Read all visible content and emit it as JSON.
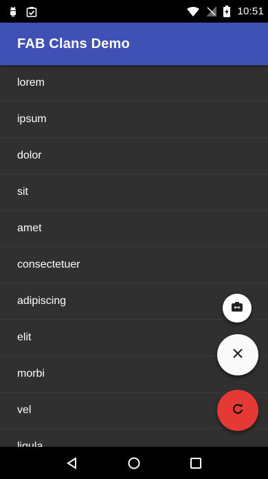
{
  "status_bar": {
    "time": "10:51",
    "icons_left": [
      "android-debug-icon",
      "clipboard-check-icon"
    ],
    "icons_right": [
      "wifi-icon",
      "no-signal-icon",
      "battery-charging-icon"
    ]
  },
  "app_bar": {
    "title": "FAB Clans Demo",
    "color": "#3f51b5"
  },
  "list": {
    "items": [
      "lorem",
      "ipsum",
      "dolor",
      "sit",
      "amet",
      "consectetuer",
      "adipiscing",
      "elit",
      "morbi",
      "vel",
      "ligula"
    ]
  },
  "fabs": {
    "mini_icon": "switch-camera-icon",
    "close_icon": "close-icon",
    "refresh_icon": "refresh-icon",
    "refresh_color": "#e53935"
  },
  "nav_bar": {
    "icons": [
      "back-icon",
      "home-icon",
      "recents-icon"
    ]
  }
}
